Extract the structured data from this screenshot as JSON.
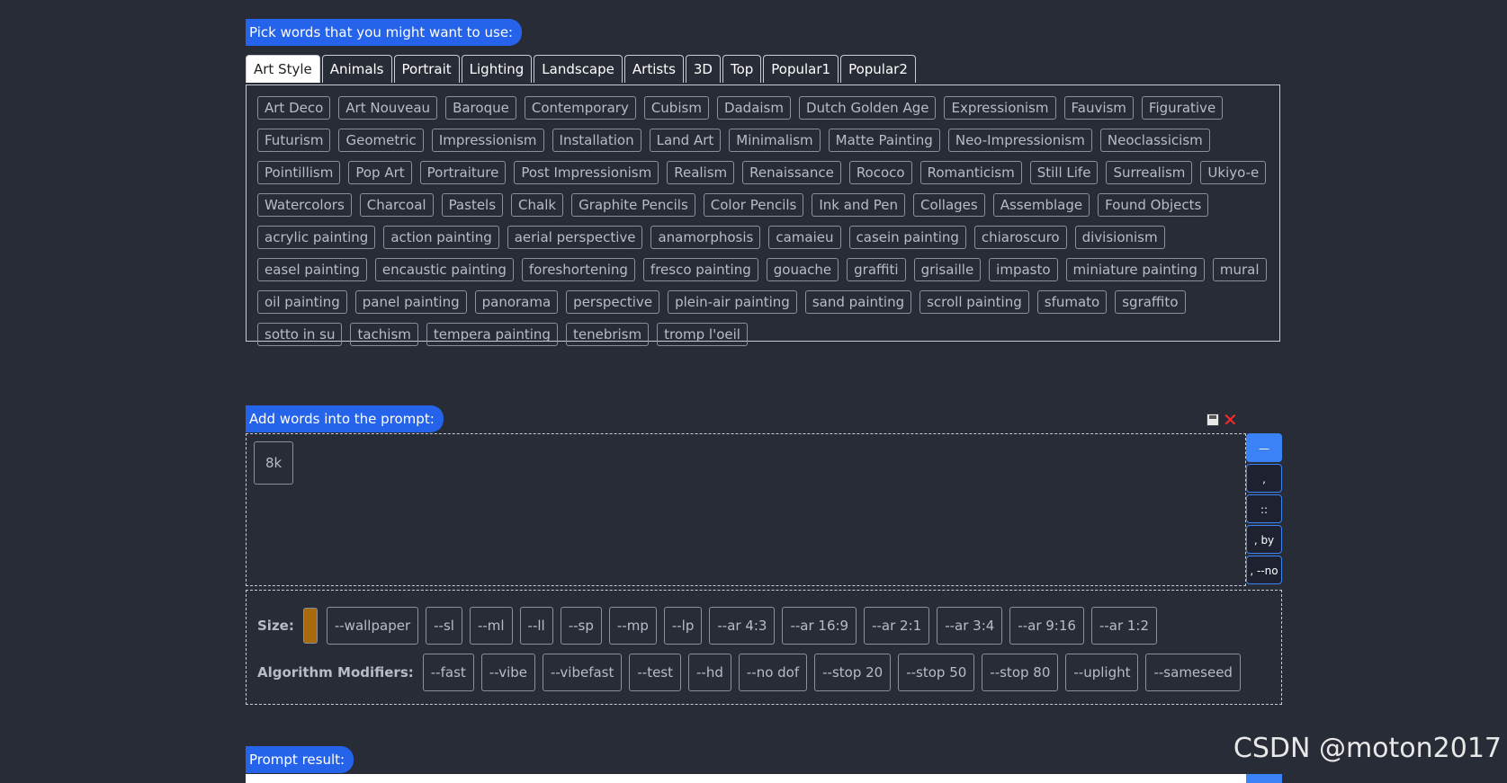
{
  "pick_label": "Pick words that you might want to use:",
  "tabs": [
    "Art Style",
    "Animals",
    "Portrait",
    "Lighting",
    "Landscape",
    "Artists",
    "3D",
    "Top",
    "Popular1",
    "Popular2"
  ],
  "active_tab": "Art Style",
  "words": [
    "Art Deco",
    "Art Nouveau",
    "Baroque",
    "Contemporary",
    "Cubism",
    "Dadaism",
    "Dutch Golden Age",
    "Expressionism",
    "Fauvism",
    "Figurative",
    "Futurism",
    "Geometric",
    "Impressionism",
    "Installation",
    "Land Art",
    "Minimalism",
    "Matte Painting",
    "Neo-Impressionism",
    "Neoclassicism",
    "Pointillism",
    "Pop Art",
    "Portraiture",
    "Post Impressionism",
    "Realism",
    "Renaissance",
    "Rococo",
    "Romanticism",
    "Still Life",
    "Surrealism",
    "Ukiyo-e",
    "Watercolors",
    "Charcoal",
    "Pastels",
    "Chalk",
    "Graphite Pencils",
    "Color Pencils",
    "Ink and Pen",
    "Collages",
    "Assemblage",
    "Found Objects",
    "acrylic painting",
    "action painting",
    "aerial perspective",
    "anamorphosis",
    "camaieu",
    "casein painting",
    "chiaroscuro",
    "divisionism",
    "easel painting",
    "encaustic painting",
    "foreshortening",
    "fresco painting",
    "gouache",
    "graffiti",
    "grisaille",
    "impasto",
    "miniature painting",
    "mural",
    "oil painting",
    "panel painting",
    "panorama",
    "perspective",
    "plein-air painting",
    "sand painting",
    "scroll painting",
    "sfumato",
    "sgraffito",
    "sotto in su",
    "tachism",
    "tempera painting",
    "tenebrism",
    "tromp l'oeil"
  ],
  "add_label": "Add words into the prompt:",
  "prompt_words": [
    "8k"
  ],
  "separators": [
    "—",
    ",",
    "::",
    ", by",
    ", --no"
  ],
  "size_label": "Size:",
  "size_color": "#a86a0c",
  "size_options": [
    "--wallpaper",
    "--sl",
    "--ml",
    "--ll",
    "--sp",
    "--mp",
    "--lp",
    "--ar 4:3",
    "--ar 16:9",
    "--ar 2:1",
    "--ar 3:4",
    "--ar 9:16",
    "--ar 1:2"
  ],
  "algo_label": "Algorithm Modifiers:",
  "algo_options": [
    "--fast",
    "--vibe",
    "--vibefast",
    "--test",
    "--hd",
    "--no dof",
    "--stop 20",
    "--stop 50",
    "--stop 80",
    "--uplight",
    "--sameseed"
  ],
  "result_label": "Prompt result:",
  "watermark": "CSDN @moton2017"
}
